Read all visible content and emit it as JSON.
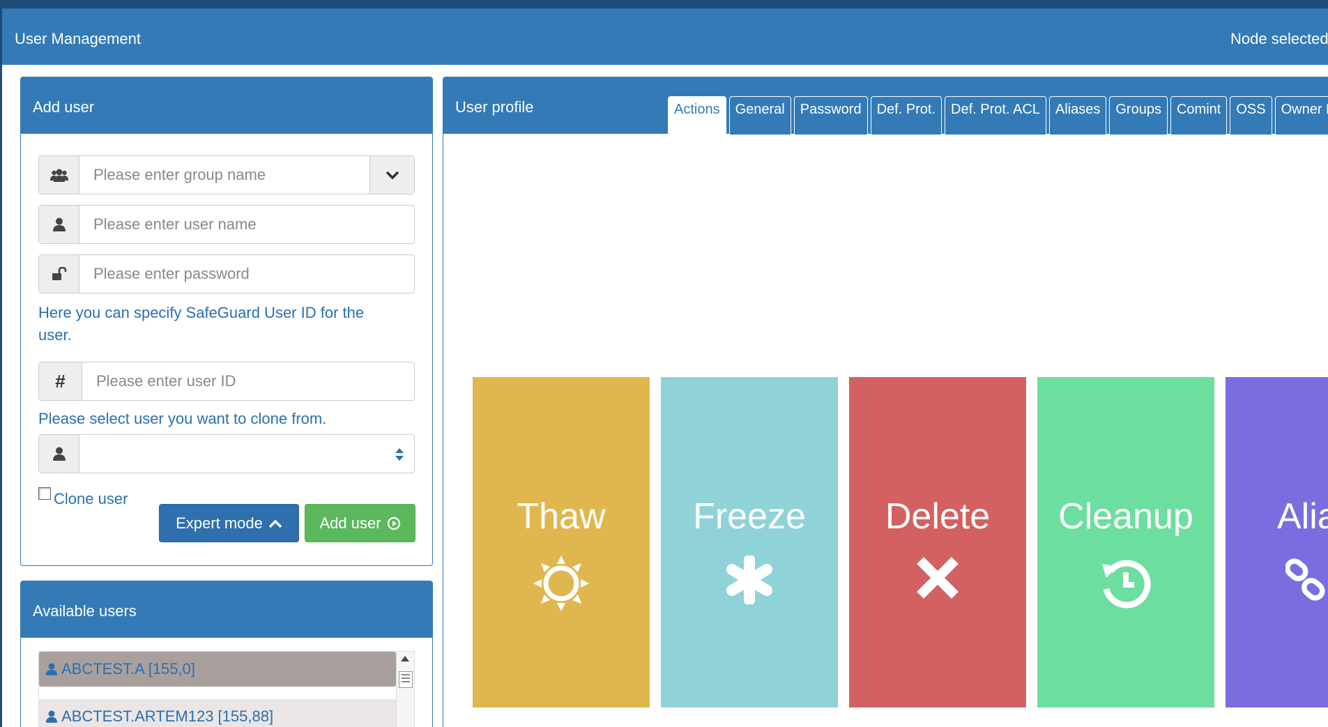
{
  "header": {
    "title": "User Management",
    "node_label": "Node selected"
  },
  "add_user": {
    "title": "Add user",
    "group_placeholder": "Please enter group name",
    "username_placeholder": "Please enter user name",
    "password_placeholder": "Please enter password",
    "userid_help": "Here you can specify SafeGuard User ID for the user.",
    "userid_placeholder": "Please enter user ID",
    "clone_help": "Please select user you want to clone from.",
    "clone_select_value": "",
    "clone_checkbox_label": "Clone user",
    "clone_checked": false,
    "expert_button": "Expert mode",
    "add_button": "Add user"
  },
  "available_users": {
    "title": "Available users",
    "users": [
      {
        "label": "ABCTEST.A [155,0]",
        "selected": true
      },
      {
        "label": "ABCTEST.ARTEM123 [155,88]",
        "selected": false
      }
    ]
  },
  "profile": {
    "title": "User profile",
    "active_tab": "Actions",
    "tabs": [
      "Actions",
      "General",
      "Password",
      "Def. Prot.",
      "Def. Prot. ACL",
      "Aliases",
      "Groups",
      "Comint",
      "OSS",
      "Owner List"
    ],
    "actions": [
      {
        "label": "Thaw",
        "icon": "sun-icon",
        "color": "#e0b74e"
      },
      {
        "label": "Freeze",
        "icon": "asterisk-icon",
        "color": "#8fd3d9"
      },
      {
        "label": "Delete",
        "icon": "close-icon",
        "color": "#d46162"
      },
      {
        "label": "Cleanup",
        "icon": "history-icon",
        "color": "#6cde9f"
      },
      {
        "label": "Aliases",
        "icon": "link-icon",
        "color": "#7a6de0"
      }
    ]
  },
  "colors": {
    "primary": "#337ab7",
    "success": "#5cb85c",
    "text_link": "#2a6fb0"
  }
}
